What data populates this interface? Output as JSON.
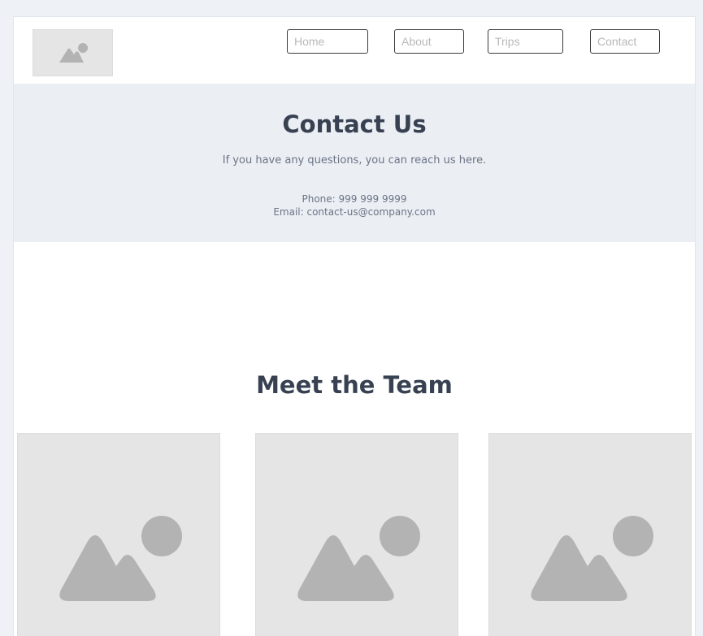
{
  "header": {
    "logo_icon": "image-placeholder-icon",
    "nav": [
      {
        "label": "Home"
      },
      {
        "label": "About"
      },
      {
        "label": "Trips"
      },
      {
        "label": "Contact"
      }
    ]
  },
  "contact": {
    "title": "Contact Us",
    "lead": "If you have any questions, you can reach us here.",
    "phone": "Phone: 999 999 9999",
    "email": "Email: contact-us@company.com"
  },
  "team": {
    "title": "Meet the Team",
    "members": [
      {
        "photo_icon": "image-placeholder-icon"
      },
      {
        "photo_icon": "image-placeholder-icon"
      },
      {
        "photo_icon": "image-placeholder-icon"
      }
    ]
  },
  "colors": {
    "page_background": "#eef1f6",
    "section_background": "#ebeef3",
    "heading": "#374151",
    "body_text": "#6b7486",
    "placeholder_fill": "#e5e5e5",
    "placeholder_glyph": "#b3b3b3"
  }
}
